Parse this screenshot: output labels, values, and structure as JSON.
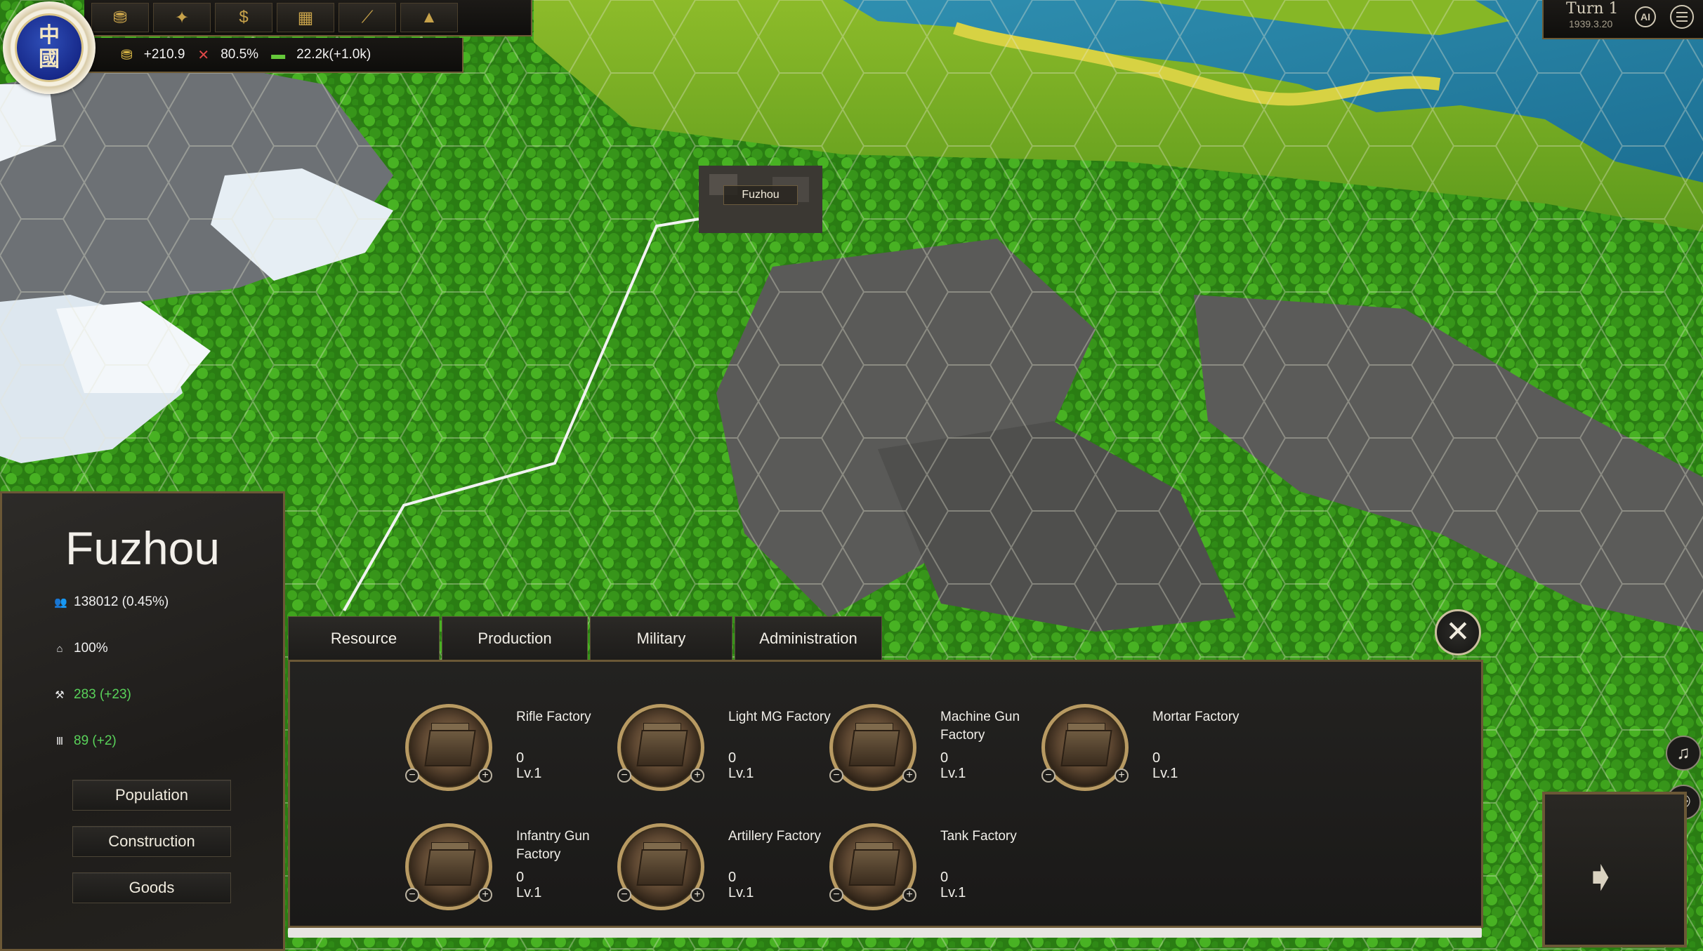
{
  "nation": {
    "emblem_text_top": "中",
    "emblem_text_bottom": "國"
  },
  "topbar": {
    "icons": [
      "gold-icon",
      "eagle-icon",
      "dollar-icon",
      "policy-icon",
      "research-icon",
      "chart-icon"
    ],
    "icon_glyphs": [
      "⛃",
      "✦",
      "$",
      "▦",
      "⟋",
      "▲"
    ],
    "stats": {
      "gold": "+210.9",
      "war_support": "80.5%",
      "money": "22.2k(+1.0k)"
    }
  },
  "turn": {
    "label": "Turn 1",
    "date": "1939.3.20",
    "ai_label": "AI"
  },
  "map": {
    "city_label": "Fuzhou"
  },
  "city_panel": {
    "name": "Fuzhou",
    "population": "138012 (0.45%)",
    "stability": "100%",
    "manpower": "283 (+23)",
    "supply": "89 (+2)",
    "buttons": [
      "Population",
      "Construction",
      "Goods"
    ]
  },
  "tabs": [
    "Resource",
    "Production",
    "Military",
    "Administration"
  ],
  "factories": [
    {
      "name": "Rifle Factory",
      "count": "0",
      "level": "Lv.1"
    },
    {
      "name": "Light MG Factory",
      "count": "0",
      "level": "Lv.1"
    },
    {
      "name": "Machine Gun Factory",
      "count": "0",
      "level": "Lv.1"
    },
    {
      "name": "Mortar Factory",
      "count": "0",
      "level": "Lv.1"
    },
    {
      "name": "Infantry Gun Factory",
      "count": "0",
      "level": "Lv.1"
    },
    {
      "name": "Artillery Factory",
      "count": "0",
      "level": "Lv.1"
    },
    {
      "name": "Tank Factory",
      "count": "0",
      "level": "Lv.1"
    }
  ],
  "controls": {
    "close": "✕",
    "minus": "−",
    "plus": "+",
    "music": "♫",
    "share": "⚇",
    "end_turn": "➧"
  },
  "colors": {
    "panel_border": "#6b5836",
    "positive_green": "#59d25a",
    "accent_gold": "#b89a62"
  }
}
